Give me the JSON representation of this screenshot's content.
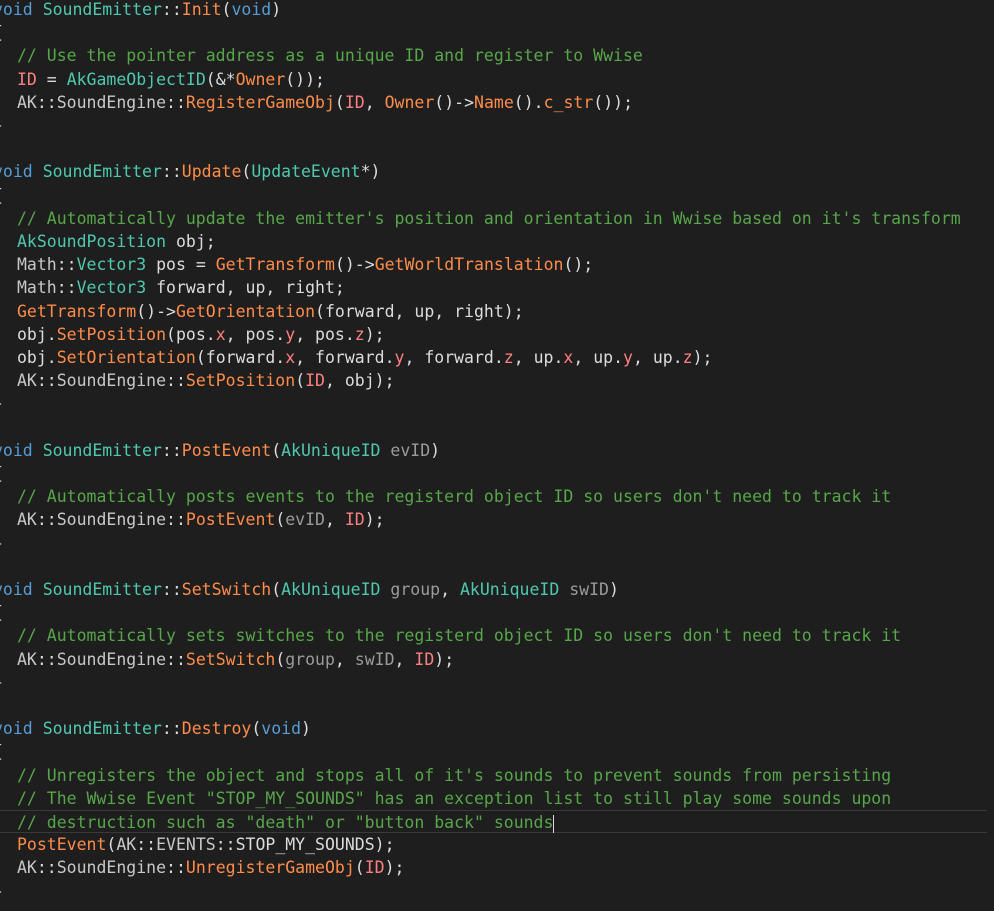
{
  "code": {
    "lines": [
      [
        {
          "c": "k",
          "t": "void"
        },
        {
          "c": "p",
          "t": " "
        },
        {
          "c": "t",
          "t": "SoundEmitter"
        },
        {
          "c": "p",
          "t": "::"
        },
        {
          "c": "f",
          "t": "Init"
        },
        {
          "c": "p",
          "t": "("
        },
        {
          "c": "k",
          "t": "void"
        },
        {
          "c": "p",
          "t": ")"
        }
      ],
      [
        {
          "c": "p",
          "t": "{"
        }
      ],
      [
        {
          "c": "i",
          "t": ""
        },
        {
          "c": "c",
          "t": "// Use the pointer address as a unique ID and register to Wwise"
        }
      ],
      [
        {
          "c": "i",
          "t": ""
        },
        {
          "c": "m",
          "t": "ID"
        },
        {
          "c": "p",
          "t": " = "
        },
        {
          "c": "t",
          "t": "AkGameObjectID"
        },
        {
          "c": "p",
          "t": "(&*"
        },
        {
          "c": "f",
          "t": "Owner"
        },
        {
          "c": "p",
          "t": "());"
        }
      ],
      [
        {
          "c": "i",
          "t": ""
        },
        {
          "c": "ns",
          "t": "AK"
        },
        {
          "c": "p",
          "t": "::"
        },
        {
          "c": "ns",
          "t": "SoundEngine"
        },
        {
          "c": "p",
          "t": "::"
        },
        {
          "c": "f",
          "t": "RegisterGameObj"
        },
        {
          "c": "p",
          "t": "("
        },
        {
          "c": "m",
          "t": "ID"
        },
        {
          "c": "p",
          "t": ", "
        },
        {
          "c": "f",
          "t": "Owner"
        },
        {
          "c": "p",
          "t": "()->"
        },
        {
          "c": "f",
          "t": "Name"
        },
        {
          "c": "p",
          "t": "()."
        },
        {
          "c": "f",
          "t": "c_str"
        },
        {
          "c": "p",
          "t": "());"
        }
      ],
      [
        {
          "c": "p",
          "t": "}"
        }
      ],
      [],
      [
        {
          "c": "k",
          "t": "void"
        },
        {
          "c": "p",
          "t": " "
        },
        {
          "c": "t",
          "t": "SoundEmitter"
        },
        {
          "c": "p",
          "t": "::"
        },
        {
          "c": "f",
          "t": "Update"
        },
        {
          "c": "p",
          "t": "("
        },
        {
          "c": "t",
          "t": "UpdateEvent"
        },
        {
          "c": "p",
          "t": "*)"
        }
      ],
      [
        {
          "c": "p",
          "t": "{"
        }
      ],
      [
        {
          "c": "i",
          "t": ""
        },
        {
          "c": "c",
          "t": "// Automatically update the emitter's position and orientation in Wwise based on it's transform"
        }
      ],
      [
        {
          "c": "i",
          "t": ""
        },
        {
          "c": "t",
          "t": "AkSoundPosition"
        },
        {
          "c": "p",
          "t": " obj;"
        }
      ],
      [
        {
          "c": "i",
          "t": ""
        },
        {
          "c": "ns",
          "t": "Math"
        },
        {
          "c": "p",
          "t": "::"
        },
        {
          "c": "t",
          "t": "Vector3"
        },
        {
          "c": "p",
          "t": " pos = "
        },
        {
          "c": "f",
          "t": "GetTransform"
        },
        {
          "c": "p",
          "t": "()->"
        },
        {
          "c": "f",
          "t": "GetWorldTranslation"
        },
        {
          "c": "p",
          "t": "();"
        }
      ],
      [
        {
          "c": "i",
          "t": ""
        },
        {
          "c": "ns",
          "t": "Math"
        },
        {
          "c": "p",
          "t": "::"
        },
        {
          "c": "t",
          "t": "Vector3"
        },
        {
          "c": "p",
          "t": " forward, up, right;"
        }
      ],
      [
        {
          "c": "i",
          "t": ""
        },
        {
          "c": "f",
          "t": "GetTransform"
        },
        {
          "c": "p",
          "t": "()->"
        },
        {
          "c": "f",
          "t": "GetOrientation"
        },
        {
          "c": "p",
          "t": "(forward, up, right);"
        }
      ],
      [
        {
          "c": "i",
          "t": ""
        },
        {
          "c": "p",
          "t": "obj."
        },
        {
          "c": "f",
          "t": "SetPosition"
        },
        {
          "c": "p",
          "t": "(pos."
        },
        {
          "c": "m",
          "t": "x"
        },
        {
          "c": "p",
          "t": ", pos."
        },
        {
          "c": "m",
          "t": "y"
        },
        {
          "c": "p",
          "t": ", pos."
        },
        {
          "c": "m",
          "t": "z"
        },
        {
          "c": "p",
          "t": ");"
        }
      ],
      [
        {
          "c": "i",
          "t": ""
        },
        {
          "c": "p",
          "t": "obj."
        },
        {
          "c": "f",
          "t": "SetOrientation"
        },
        {
          "c": "p",
          "t": "(forward."
        },
        {
          "c": "m",
          "t": "x"
        },
        {
          "c": "p",
          "t": ", forward."
        },
        {
          "c": "m",
          "t": "y"
        },
        {
          "c": "p",
          "t": ", forward."
        },
        {
          "c": "m",
          "t": "z"
        },
        {
          "c": "p",
          "t": ", up."
        },
        {
          "c": "m",
          "t": "x"
        },
        {
          "c": "p",
          "t": ", up."
        },
        {
          "c": "m",
          "t": "y"
        },
        {
          "c": "p",
          "t": ", up."
        },
        {
          "c": "m",
          "t": "z"
        },
        {
          "c": "p",
          "t": ");"
        }
      ],
      [
        {
          "c": "i",
          "t": ""
        },
        {
          "c": "ns",
          "t": "AK"
        },
        {
          "c": "p",
          "t": "::"
        },
        {
          "c": "ns",
          "t": "SoundEngine"
        },
        {
          "c": "p",
          "t": "::"
        },
        {
          "c": "f",
          "t": "SetPosition"
        },
        {
          "c": "p",
          "t": "("
        },
        {
          "c": "m",
          "t": "ID"
        },
        {
          "c": "p",
          "t": ", obj);"
        }
      ],
      [
        {
          "c": "p",
          "t": "}"
        }
      ],
      [],
      [
        {
          "c": "k",
          "t": "void"
        },
        {
          "c": "p",
          "t": " "
        },
        {
          "c": "t",
          "t": "SoundEmitter"
        },
        {
          "c": "p",
          "t": "::"
        },
        {
          "c": "f",
          "t": "PostEvent"
        },
        {
          "c": "p",
          "t": "("
        },
        {
          "c": "t",
          "t": "AkUniqueID"
        },
        {
          "c": "p",
          "t": " "
        },
        {
          "c": "pv",
          "t": "evID"
        },
        {
          "c": "p",
          "t": ")"
        }
      ],
      [
        {
          "c": "p",
          "t": "{"
        }
      ],
      [
        {
          "c": "i",
          "t": ""
        },
        {
          "c": "c",
          "t": "// Automatically posts events to the registerd object ID so users don't need to track it"
        }
      ],
      [
        {
          "c": "i",
          "t": ""
        },
        {
          "c": "ns",
          "t": "AK"
        },
        {
          "c": "p",
          "t": "::"
        },
        {
          "c": "ns",
          "t": "SoundEngine"
        },
        {
          "c": "p",
          "t": "::"
        },
        {
          "c": "f",
          "t": "PostEvent"
        },
        {
          "c": "p",
          "t": "("
        },
        {
          "c": "pv",
          "t": "evID"
        },
        {
          "c": "p",
          "t": ", "
        },
        {
          "c": "m",
          "t": "ID"
        },
        {
          "c": "p",
          "t": ");"
        }
      ],
      [
        {
          "c": "p",
          "t": "}"
        }
      ],
      [],
      [
        {
          "c": "k",
          "t": "void"
        },
        {
          "c": "p",
          "t": " "
        },
        {
          "c": "t",
          "t": "SoundEmitter"
        },
        {
          "c": "p",
          "t": "::"
        },
        {
          "c": "f",
          "t": "SetSwitch"
        },
        {
          "c": "p",
          "t": "("
        },
        {
          "c": "t",
          "t": "AkUniqueID"
        },
        {
          "c": "p",
          "t": " "
        },
        {
          "c": "pv",
          "t": "group"
        },
        {
          "c": "p",
          "t": ", "
        },
        {
          "c": "t",
          "t": "AkUniqueID"
        },
        {
          "c": "p",
          "t": " "
        },
        {
          "c": "pv",
          "t": "swID"
        },
        {
          "c": "p",
          "t": ")"
        }
      ],
      [
        {
          "c": "p",
          "t": "{"
        }
      ],
      [
        {
          "c": "i",
          "t": ""
        },
        {
          "c": "c",
          "t": "// Automatically sets switches to the registerd object ID so users don't need to track it"
        }
      ],
      [
        {
          "c": "i",
          "t": ""
        },
        {
          "c": "ns",
          "t": "AK"
        },
        {
          "c": "p",
          "t": "::"
        },
        {
          "c": "ns",
          "t": "SoundEngine"
        },
        {
          "c": "p",
          "t": "::"
        },
        {
          "c": "f",
          "t": "SetSwitch"
        },
        {
          "c": "p",
          "t": "("
        },
        {
          "c": "pv",
          "t": "group"
        },
        {
          "c": "p",
          "t": ", "
        },
        {
          "c": "pv",
          "t": "swID"
        },
        {
          "c": "p",
          "t": ", "
        },
        {
          "c": "m",
          "t": "ID"
        },
        {
          "c": "p",
          "t": ");"
        }
      ],
      [
        {
          "c": "p",
          "t": "}"
        }
      ],
      [],
      [
        {
          "c": "k",
          "t": "void"
        },
        {
          "c": "p",
          "t": " "
        },
        {
          "c": "t",
          "t": "SoundEmitter"
        },
        {
          "c": "p",
          "t": "::"
        },
        {
          "c": "f",
          "t": "Destroy"
        },
        {
          "c": "p",
          "t": "("
        },
        {
          "c": "k",
          "t": "void"
        },
        {
          "c": "p",
          "t": ")"
        }
      ],
      [
        {
          "c": "p",
          "t": "{"
        }
      ],
      [
        {
          "c": "i",
          "t": ""
        },
        {
          "c": "c",
          "t": "// Unregisters the object and stops all of it's sounds to prevent sounds from persisting"
        }
      ],
      [
        {
          "c": "i",
          "t": ""
        },
        {
          "c": "c",
          "t": "// The Wwise Event \"STOP_MY_SOUNDS\" has an exception list to still play some sounds upon"
        }
      ],
      [
        {
          "c": "i",
          "t": ""
        },
        {
          "c": "c",
          "t": "// destruction such as \"death\" or \"button back\" sounds"
        },
        {
          "c": "cursor",
          "t": ""
        }
      ],
      [
        {
          "c": "i",
          "t": ""
        },
        {
          "c": "f",
          "t": "PostEvent"
        },
        {
          "c": "p",
          "t": "("
        },
        {
          "c": "ns",
          "t": "AK"
        },
        {
          "c": "p",
          "t": "::"
        },
        {
          "c": "ns",
          "t": "EVENTS"
        },
        {
          "c": "p",
          "t": "::"
        },
        {
          "c": "p",
          "t": "STOP_MY_SOUNDS);"
        }
      ],
      [
        {
          "c": "i",
          "t": ""
        },
        {
          "c": "ns",
          "t": "AK"
        },
        {
          "c": "p",
          "t": "::"
        },
        {
          "c": "ns",
          "t": "SoundEngine"
        },
        {
          "c": "p",
          "t": "::"
        },
        {
          "c": "f",
          "t": "UnregisterGameObj"
        },
        {
          "c": "p",
          "t": "("
        },
        {
          "c": "m",
          "t": "ID"
        },
        {
          "c": "p",
          "t": ");"
        }
      ],
      [
        {
          "c": "p",
          "t": "}"
        }
      ]
    ]
  },
  "theme": {
    "background": "#1e1e1e",
    "keyword": "#569cd6",
    "type": "#4ec9b0",
    "function": "#ff8c4a",
    "comment": "#57a64a",
    "member": "#ff8080",
    "namespace": "#c8c8c8",
    "parameter": "#9b9b9b"
  }
}
